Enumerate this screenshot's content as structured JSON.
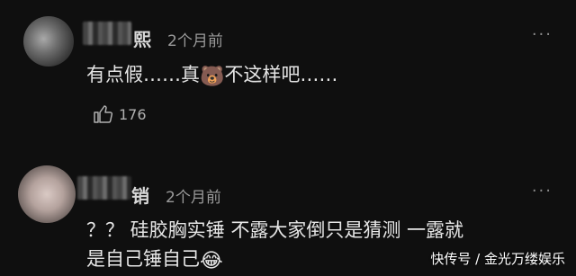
{
  "comments": [
    {
      "name_suffix": "熙",
      "time": "2个月前",
      "more": "···",
      "text_before": "有点假……真",
      "emoji": "🐻",
      "text_after": "不这样吧……",
      "likes": "176"
    },
    {
      "name_suffix": "销",
      "time": "2个月前",
      "more": "···",
      "text_line1": "？？ 硅胶胸实锤 不露大家倒只是猜测 一露就",
      "text_line2": "是自己锤自己",
      "emoji": "😂"
    }
  ],
  "watermark": "快传号 / 金光万缕娱乐",
  "icons": {
    "like": "thumbs-up-icon",
    "more": "more-dots-icon"
  }
}
